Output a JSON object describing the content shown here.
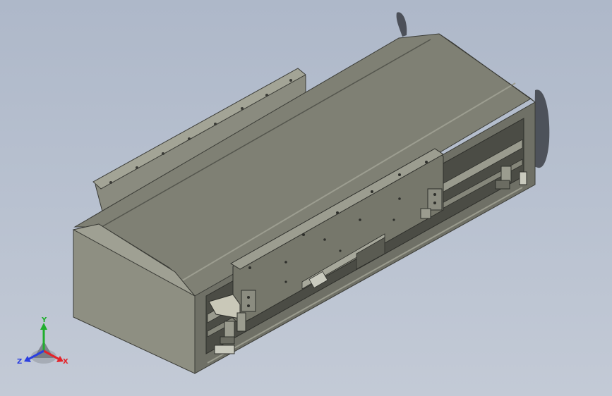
{
  "view": {
    "background_top": "#aeb8c9",
    "background_bottom": "#c3cad6",
    "body_color": "#8e8f82",
    "top_color": "#7f8074",
    "carriage_color": "#76776b"
  },
  "triad": {
    "x_label": "X",
    "y_label": "Y",
    "z_label": "Z",
    "x_color": "#e3242b",
    "y_color": "#1fae2d",
    "z_color": "#2b3fe0"
  }
}
